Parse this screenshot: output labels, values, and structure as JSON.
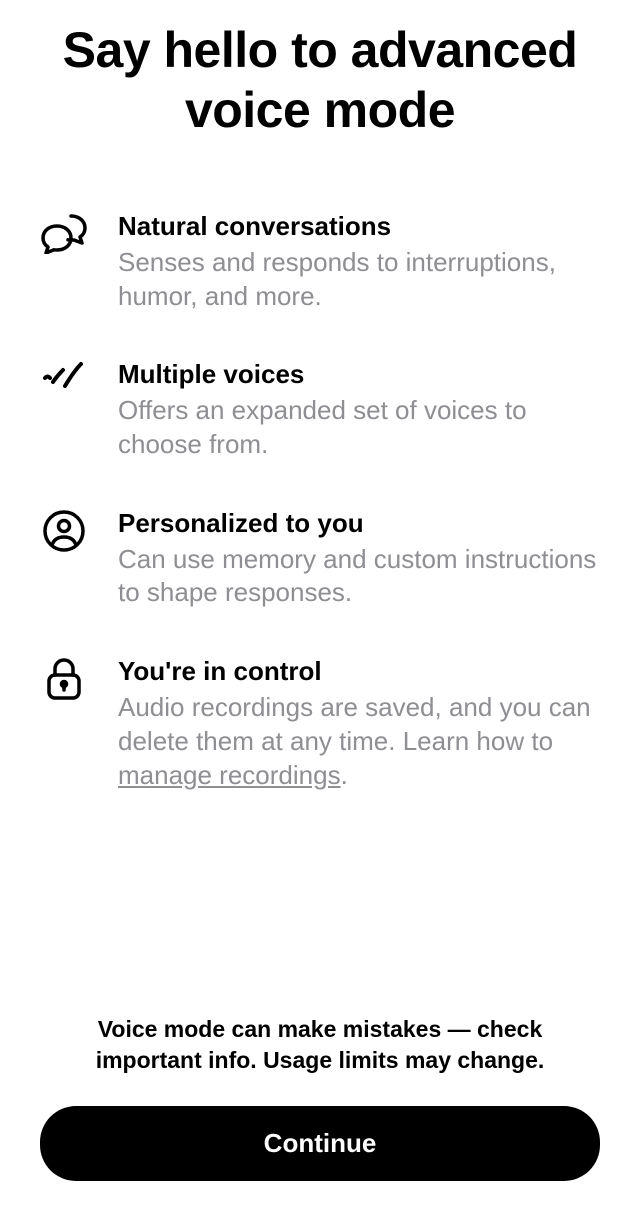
{
  "heading": "Say hello to advanced voice mode",
  "features": [
    {
      "title": "Natural conversations",
      "desc": "Senses and responds to interruptions, humor, and more."
    },
    {
      "title": "Multiple voices",
      "desc": "Offers an expanded set of voices to choose from."
    },
    {
      "title": "Personalized to you",
      "desc": "Can use memory and custom instructions to shape responses."
    },
    {
      "title": "You're in control",
      "desc_prefix": "Audio recordings are saved, and you can delete them at any time. Learn how to ",
      "link_text": "manage recordings",
      "desc_suffix": "."
    }
  ],
  "disclaimer": "Voice mode can make mistakes — check important info. Usage limits may change.",
  "continue_label": "Continue"
}
